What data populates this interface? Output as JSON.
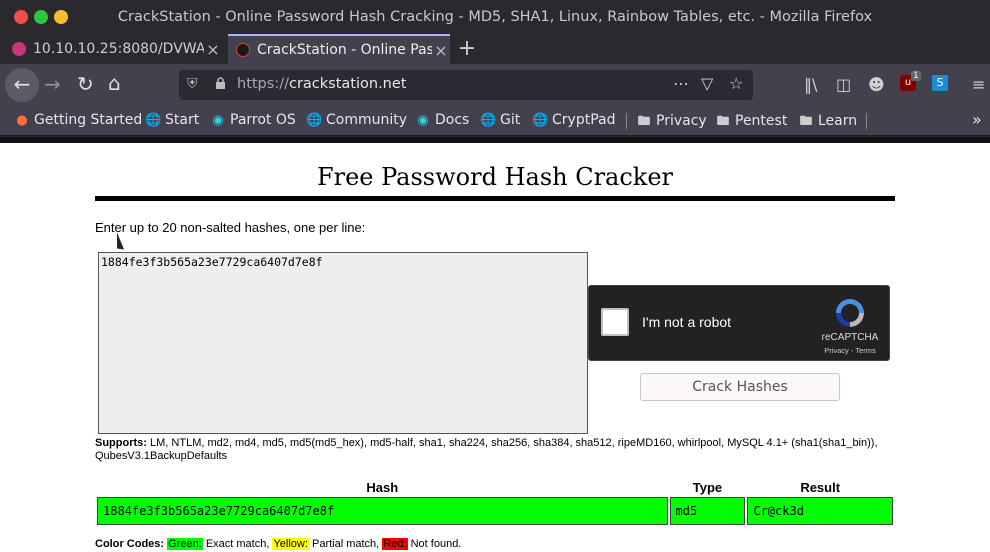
{
  "window": {
    "title": "CrackStation - Online Password Hash Cracking - MD5, SHA1, Linux, Rainbow Tables, etc. - Mozilla Firefox"
  },
  "tabs": [
    {
      "label": "10.10.10.25:8080/DVWA/",
      "close": "×"
    },
    {
      "label": "CrackStation - Online Password",
      "close": "×"
    }
  ],
  "newtab": "+",
  "url": {
    "scheme": "https://",
    "host": "crackstation.net"
  },
  "toolbar": {
    "ublock_badge": "1"
  },
  "bookmarks": [
    {
      "label": "Getting Started",
      "icon": "firefox-icon"
    },
    {
      "label": "Start",
      "icon": "globe-icon"
    },
    {
      "label": "Parrot OS",
      "icon": "parrot-icon"
    },
    {
      "label": "Community",
      "icon": "globe-icon"
    },
    {
      "label": "Docs",
      "icon": "parrot-icon"
    },
    {
      "label": "Git",
      "icon": "globe-icon"
    },
    {
      "label": "CryptPad",
      "icon": "globe-icon"
    },
    {
      "label": "Privacy",
      "icon": "folder-icon"
    },
    {
      "label": "Pentest",
      "icon": "folder-icon"
    },
    {
      "label": "Learn",
      "icon": "folder-icon"
    }
  ],
  "page": {
    "title": "Free Password Hash Cracker",
    "instructions": "Enter up to 20 non-salted hashes, one per line:",
    "hash_input": "1884fe3f3b565a23e7729ca6407d7e8f",
    "recaptcha": {
      "label": "I'm not a robot",
      "brand": "reCAPTCHA",
      "terms": "Privacy - Terms"
    },
    "crack_button": "Crack Hashes",
    "supports_label": "Supports:",
    "supports_text": "LM, NTLM, md2, md4, md5, md5(md5_hex), md5-half, sha1, sha224, sha256, sha384, sha512, ripeMD160, whirlpool, MySQL 4.1+ (sha1(sha1_bin)), QubesV3.1BackupDefaults",
    "results": {
      "headers": [
        "Hash",
        "Type",
        "Result"
      ],
      "rows": [
        {
          "hash": "1884fe3f3b565a23e7729ca6407d7e8f",
          "type": "md5",
          "result": "Cr@ck3d"
        }
      ]
    },
    "color_codes": {
      "label": "Color Codes:",
      "green": "Green:",
      "green_text": "Exact match,",
      "yellow": "Yellow:",
      "yellow_text": "Partial match,",
      "red": "Red:",
      "red_text": "Not found."
    }
  },
  "colors": {
    "exact": "#00ff00",
    "partial": "#ffff00",
    "notfound": "#ff0000"
  }
}
